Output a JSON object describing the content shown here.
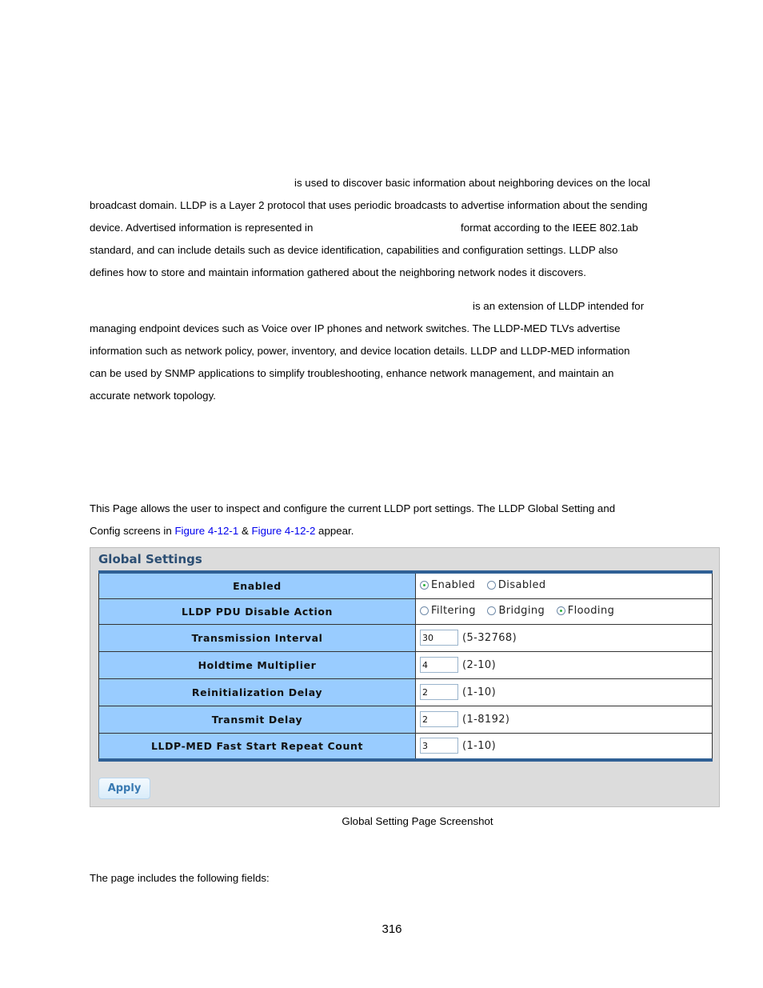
{
  "intro": {
    "lines": [
      "is used to discover basic information about neighboring devices on the local",
      "broadcast domain. LLDP is a Layer 2 protocol that uses periodic broadcasts to advertise information about the sending",
      "device. Advertised information is represented in",
      "format according to the IEEE 802.1ab",
      "standard, and can include details such as device identification, capabilities and configuration settings. LLDP also",
      "defines how to store and maintain information gathered about the neighboring network nodes it discovers."
    ]
  },
  "med": {
    "lines": [
      "is an extension of LLDP intended for",
      "managing endpoint devices such as Voice over IP phones and network switches. The LLDP-MED TLVs advertise",
      "information such as network policy, power, inventory, and device location details. LLDP and LLDP-MED information",
      "can be used by SNMP applications to simplify troubleshooting, enhance network management, and maintain an",
      "accurate network topology."
    ]
  },
  "desc": {
    "line1": "This Page allows the user to inspect and configure the current LLDP port settings. The LLDP Global Setting and",
    "line2_pre": "Config screens in ",
    "link1": "Figure 4-12-1",
    "amp": " & ",
    "link2": "Figure 4-12-2",
    "line2_post": " appear."
  },
  "panel": {
    "title": "Global Settings",
    "rows": {
      "enabled": {
        "label": "Enabled",
        "options": [
          "Enabled",
          "Disabled"
        ],
        "selected": "Enabled"
      },
      "pdu": {
        "label": "LLDP PDU Disable Action",
        "options": [
          "Filtering",
          "Bridging",
          "Flooding"
        ],
        "selected": "Flooding"
      },
      "tx_interval": {
        "label": "Transmission Interval",
        "value": "30",
        "range": "(5-32768)"
      },
      "holdtime": {
        "label": "Holdtime Multiplier",
        "value": "4",
        "range": "(2-10)"
      },
      "reinit": {
        "label": "Reinitialization Delay",
        "value": "2",
        "range": "(1-10)"
      },
      "tx_delay": {
        "label": "Transmit Delay",
        "value": "2",
        "range": "(1-8192)"
      },
      "med_fast": {
        "label": "LLDP-MED Fast Start Repeat Count",
        "value": "3",
        "range": "(1-10)"
      }
    },
    "apply_label": "Apply"
  },
  "caption": "Global Setting Page Screenshot",
  "fields_intro": "The page includes the following fields:",
  "page_number": "316"
}
